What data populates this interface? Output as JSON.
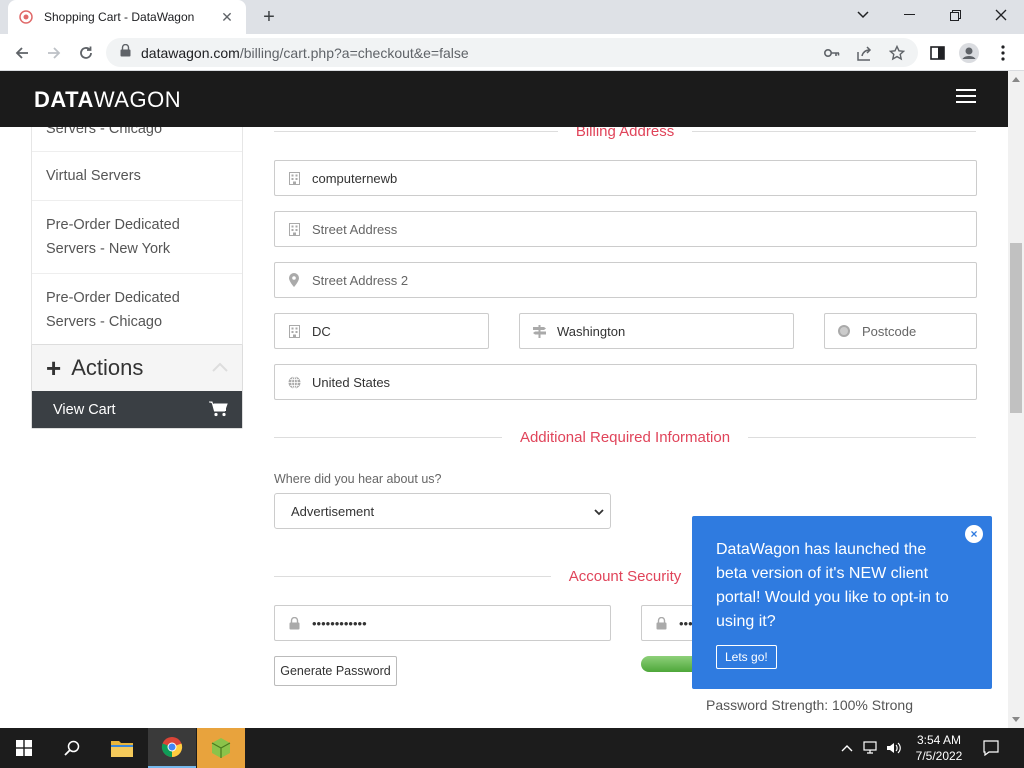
{
  "browser": {
    "tab_title": "Shopping Cart - DataWagon",
    "url_host": "datawagon.com",
    "url_path": "/billing/cart.php?a=checkout&e=false"
  },
  "site": {
    "logo_bold": "DATA",
    "logo_light": "WAGON"
  },
  "sidebar": {
    "items": [
      {
        "label": "Servers - Chicago"
      },
      {
        "label": "Virtual Servers"
      },
      {
        "label": "Pre-Order Dedicated Servers - New York"
      },
      {
        "label": "Pre-Order Dedicated Servers - Chicago"
      }
    ]
  },
  "actions": {
    "title": "Actions",
    "view_cart": "View Cart"
  },
  "billing": {
    "heading": "Billing Address",
    "company_value": "computernewb",
    "street_placeholder": "Street Address",
    "street2_placeholder": "Street Address 2",
    "state_value": "DC",
    "city_value": "Washington",
    "postcode_placeholder": "Postcode",
    "country_value": "United States"
  },
  "additional": {
    "heading": "Additional Required Information",
    "question": "Where did you hear about us?",
    "selected": "Advertisement"
  },
  "security": {
    "heading": "Account Security",
    "password_mask": "••••••••••••",
    "confirm_mask": "•••",
    "generate_label": "Generate Password",
    "strength_text": "Password Strength: 100% Strong",
    "strength_percent": 100
  },
  "popup": {
    "message": "DataWagon has launched the beta version of it's NEW client portal! Would you like to opt-in to using it?",
    "button": "Lets go!",
    "close": "×"
  },
  "taskbar": {
    "time": "3:54 AM",
    "date": "7/5/2022"
  },
  "colors": {
    "accent_red": "#e0445a",
    "header_bg": "#1b1b1b",
    "popup_blue": "#2f7be0"
  }
}
